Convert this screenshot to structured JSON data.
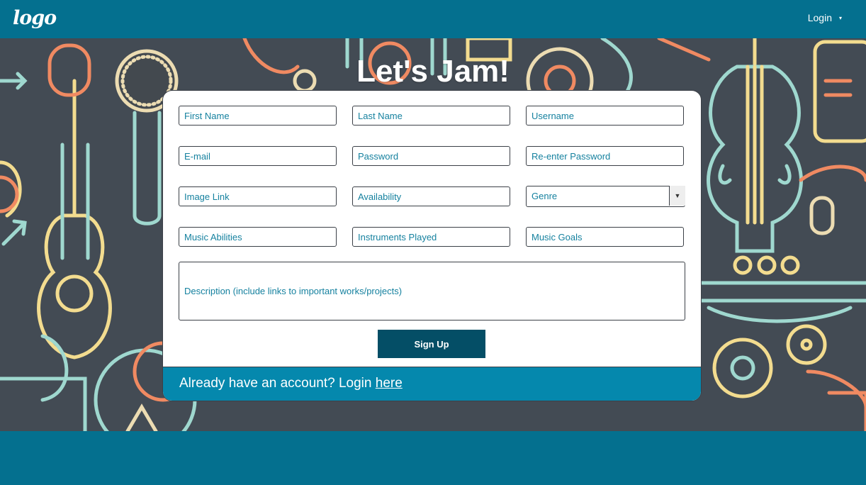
{
  "header": {
    "logo": "logo",
    "login_label": "Login",
    "login_caret": "▾"
  },
  "hero": {
    "title": "Let's Jam!"
  },
  "form": {
    "row1": [
      "First Name",
      "Last Name",
      "Username"
    ],
    "row2": [
      "E-mail",
      "Password",
      "Re-enter Password"
    ],
    "row3": [
      "Image Link",
      "Availability"
    ],
    "genre": {
      "label": "Genre",
      "arrow": "▼"
    },
    "row4": [
      "Music Abilities",
      "Instruments Played",
      "Music Goals"
    ],
    "description_placeholder": "Description (include links to important works/projects)",
    "submit_label": "Sign Up"
  },
  "footer": {
    "text": "Already have an account? Login ",
    "link_label": "here"
  },
  "colors": {
    "primary": "#04708f",
    "button": "#044e66",
    "footer": "#0588ad",
    "field_text": "#15819f",
    "hero_bg": "#434b54"
  },
  "icons": [
    "caret-down-icon",
    "select-arrow-icon"
  ]
}
